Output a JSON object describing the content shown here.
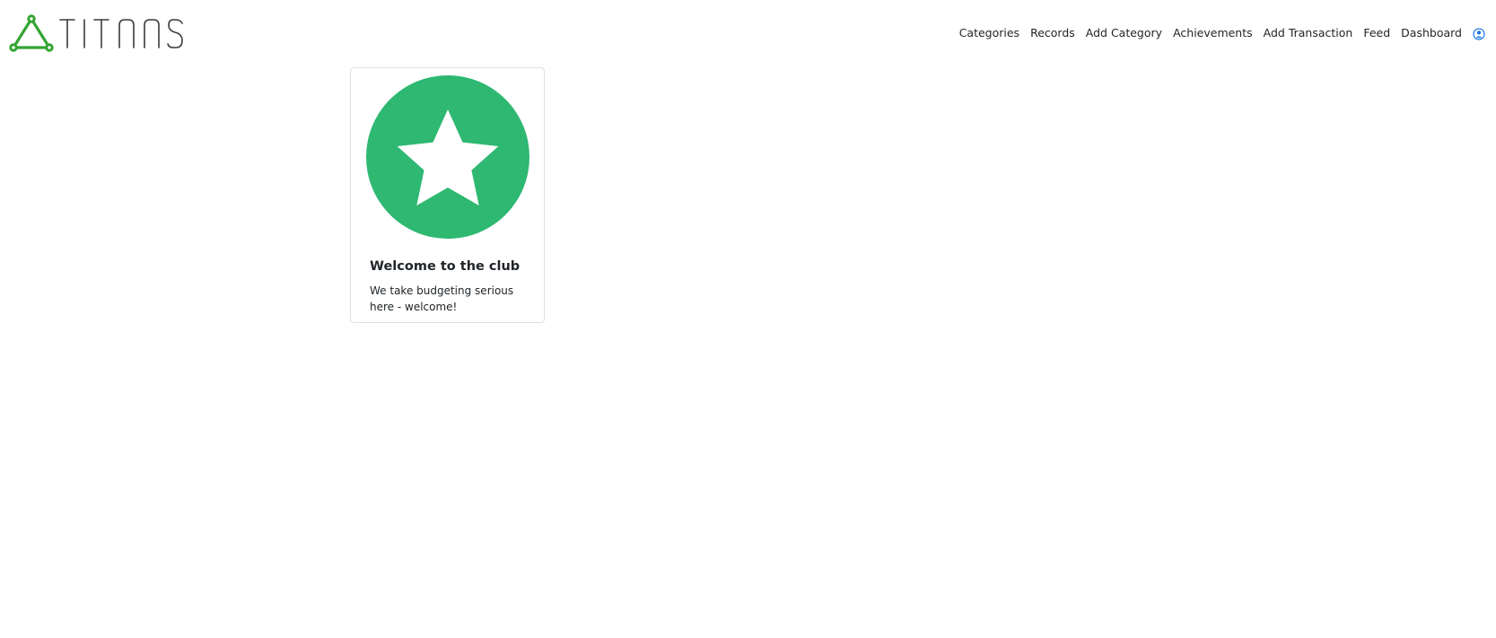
{
  "brand": {
    "name": "TITANS",
    "logo_color": "#33a532",
    "text_color": "#3a3a3a"
  },
  "nav": {
    "links": [
      {
        "label": "Categories"
      },
      {
        "label": "Records"
      },
      {
        "label": "Add Category"
      },
      {
        "label": "Achievements"
      },
      {
        "label": "Add Transaction"
      },
      {
        "label": "Feed"
      },
      {
        "label": "Dashboard"
      }
    ],
    "user_icon": "user-circle-icon",
    "user_icon_color": "#1a73e8"
  },
  "achievement": {
    "icon": "star-icon",
    "badge_color": "#2eb872",
    "title": "Welcome to the club",
    "description": "We take budgeting serious here - welcome!"
  }
}
